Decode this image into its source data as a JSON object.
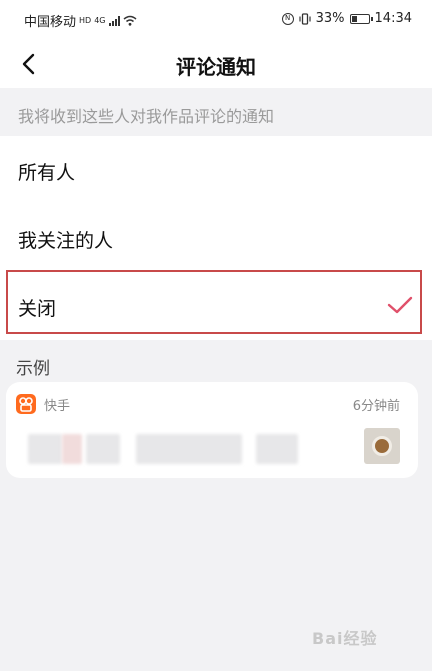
{
  "status_bar": {
    "carrier": "中国移动",
    "network_badge": "HD",
    "network_type": "4G",
    "battery_percent": "33%",
    "time": "14:34",
    "icons": [
      "hd-icon",
      "signal-icon",
      "wifi-icon",
      "nfc-icon",
      "vibrate-icon",
      "battery-icon"
    ]
  },
  "header": {
    "title": "评论通知",
    "back_icon": "chevron-left-icon"
  },
  "section_hint": "我将收到这些人对我作品评论的通知",
  "options": [
    {
      "label": "所有人",
      "selected": false
    },
    {
      "label": "我关注的人",
      "selected": false
    },
    {
      "label": "关闭",
      "selected": true
    }
  ],
  "colors": {
    "check": "#e0506a",
    "highlight_border": "#c84a4a",
    "app_icon": "#ff6a1e"
  },
  "example": {
    "title": "示例",
    "app_name": "快手",
    "time_ago": "6分钟前"
  },
  "watermark": "Bai经验"
}
